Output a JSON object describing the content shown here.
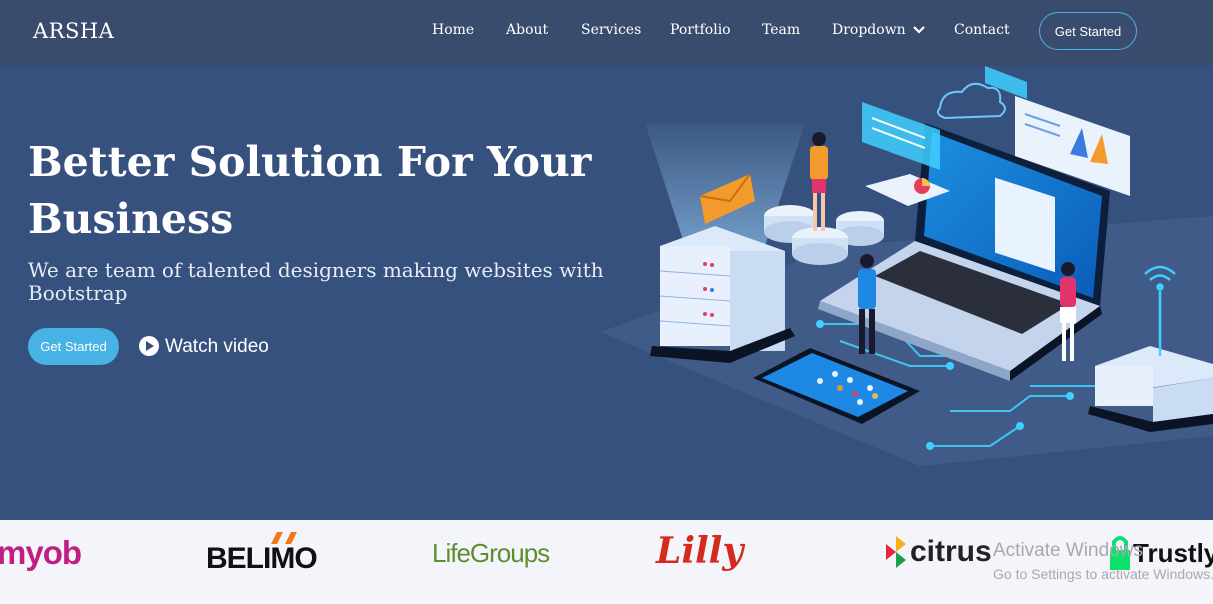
{
  "brand": "ARSHA",
  "nav": {
    "items": [
      "Home",
      "About",
      "Services",
      "Portfolio",
      "Team",
      "Dropdown",
      "Contact"
    ],
    "cta": "Get Started"
  },
  "hero": {
    "title": "Better Solution For Your Business",
    "subtitle": "We are team of talented designers making websites with Bootstrap",
    "primary_button": "Get Started",
    "video_link": "Watch video"
  },
  "clients": [
    "myob",
    "BELIMO",
    "LifeGroups",
    "Lilly",
    "citrus",
    "Trustly"
  ],
  "watermark": {
    "line1": "Activate Windows",
    "line2": "Go to Settings to activate Windows."
  },
  "colors": {
    "header_bg": "#3a4c6d",
    "hero_bg": "#37517e",
    "accent": "#47b2e4",
    "clients_bg": "#f3f5fa"
  }
}
